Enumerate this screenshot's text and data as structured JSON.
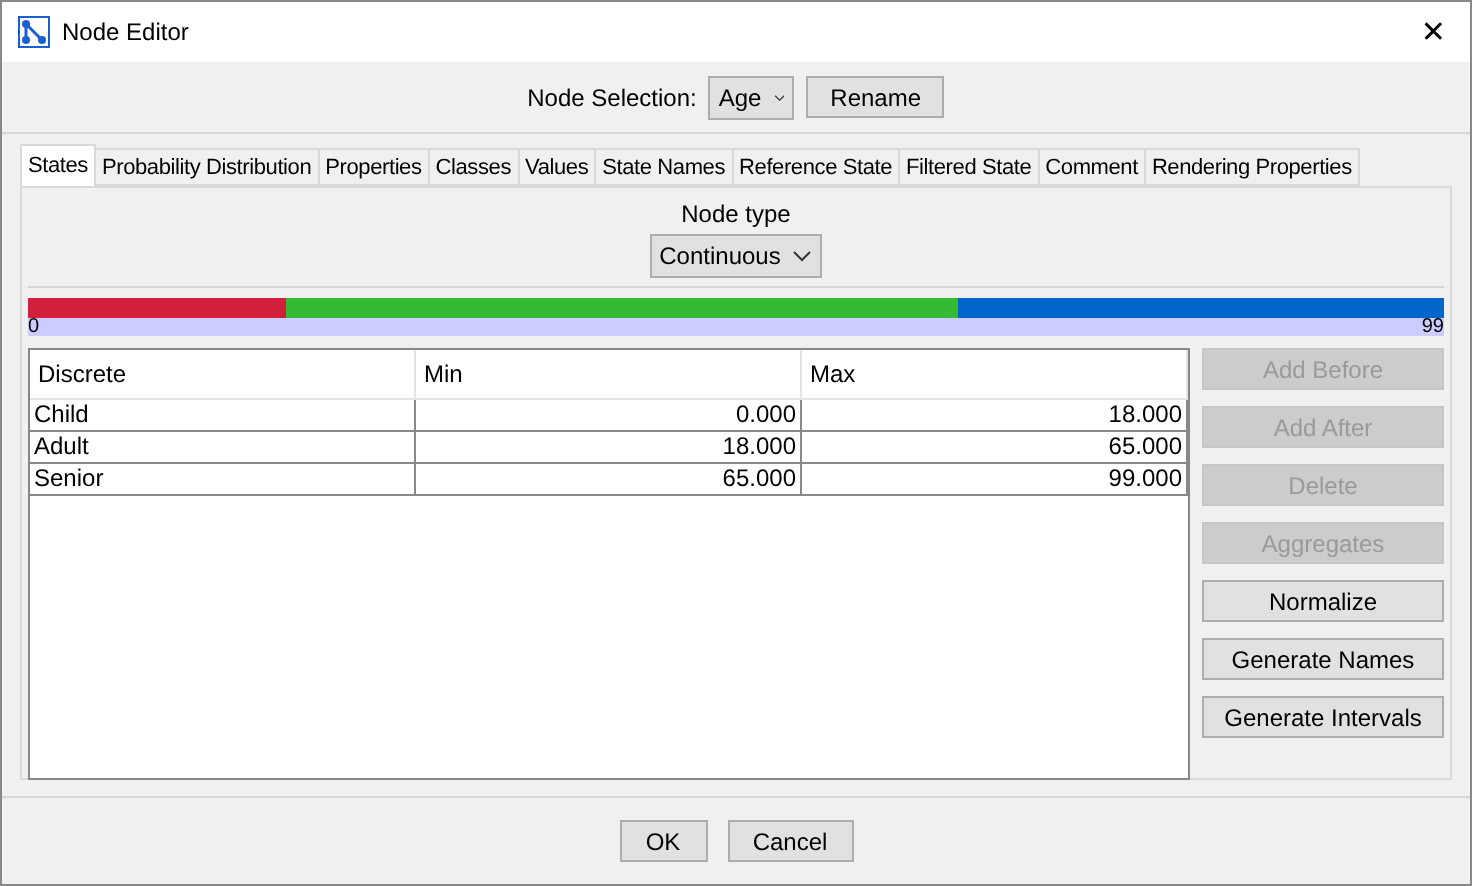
{
  "window": {
    "title": "Node Editor",
    "close": "✕"
  },
  "node_selection": {
    "label": "Node Selection:",
    "value": "Age",
    "rename": "Rename"
  },
  "tabs": [
    {
      "label": "States",
      "selected": true
    },
    {
      "label": "Probability Distribution",
      "selected": false
    },
    {
      "label": "Properties",
      "selected": false
    },
    {
      "label": "Classes",
      "selected": false
    },
    {
      "label": "Values",
      "selected": false
    },
    {
      "label": "State Names",
      "selected": false
    },
    {
      "label": "Reference State",
      "selected": false
    },
    {
      "label": "Filtered State",
      "selected": false
    },
    {
      "label": "Comment",
      "selected": false
    },
    {
      "label": "Rendering Properties",
      "selected": false
    }
  ],
  "node_type": {
    "label": "Node type",
    "value": "Continuous"
  },
  "scale": {
    "min": "0",
    "max": "99"
  },
  "table": {
    "columns": [
      "Discrete",
      "Min",
      "Max"
    ],
    "rows": [
      {
        "name": "Child",
        "min": "0.000",
        "max": "18.000",
        "color": "#d21f3c"
      },
      {
        "name": "Adult",
        "min": "18.000",
        "max": "65.000",
        "color": "#33bb33"
      },
      {
        "name": "Senior",
        "min": "65.000",
        "max": "99.000",
        "color": "#0066cc"
      }
    ]
  },
  "side_buttons": [
    {
      "label": "Add Before",
      "disabled": true
    },
    {
      "label": "Add After",
      "disabled": true
    },
    {
      "label": "Delete",
      "disabled": true
    },
    {
      "label": "Aggregates",
      "disabled": true
    },
    {
      "label": "Normalize",
      "disabled": false
    },
    {
      "label": "Generate Names",
      "disabled": false
    },
    {
      "label": "Generate Intervals",
      "disabled": false
    }
  ],
  "footer_buttons": [
    "OK",
    "Cancel"
  ]
}
